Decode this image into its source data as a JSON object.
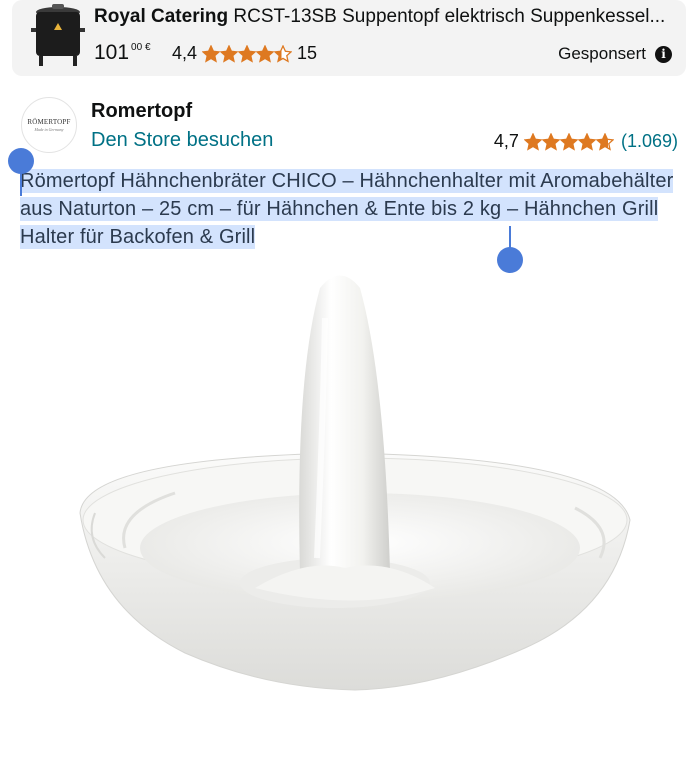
{
  "ad": {
    "brand": "Royal Catering",
    "title_rest": "RCST-13SB Suppentopf elektrisch Suppenkessel...",
    "price_whole": "101",
    "price_fraction": "00 €",
    "rating": "4,4",
    "stars": 4.4,
    "review_count": "15",
    "sponsored_label": "Gesponsert",
    "thumb_icon": "soup-kettle-image"
  },
  "store": {
    "name": "Romertopf",
    "logo_text": "RÖMERTOPF",
    "logo_sub": "Made in Germany",
    "visit_link": "Den Store besuchen",
    "rating": "4,7",
    "stars": 4.7,
    "rating_count": "(1.069)"
  },
  "product": {
    "title": "Römertopf Hähnchenbräter CHICO – Hähnchenhalter mit Aromabehälter aus Naturton – 25 cm – für Hähnchen & Ente bis 2 kg – Hähnchen Grill Halter für Backofen & Grill",
    "image_icon": "chicken-roaster-image"
  },
  "colors": {
    "link": "#007185",
    "star": "#de7921",
    "selection": "#d3e3fd",
    "handle": "#4a7bd8",
    "ad_background": "#f3f3f3"
  }
}
